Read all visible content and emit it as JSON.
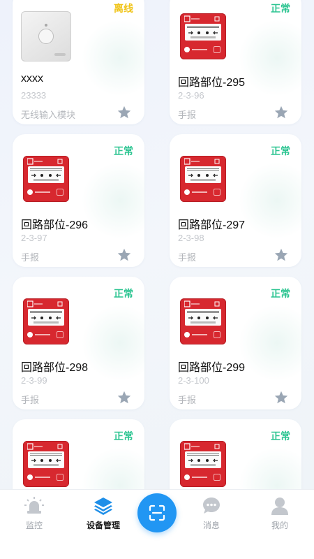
{
  "devices": [
    {
      "status": "离线",
      "status_type": "offline",
      "thumb": "wireless-module",
      "name": "xxxx",
      "code": "23333",
      "type": "无线输入模块"
    },
    {
      "status": "正常",
      "status_type": "normal",
      "thumb": "fire-alarm-button",
      "name": "回路部位-295",
      "code": "2-3-96",
      "type": "手报"
    },
    {
      "status": "正常",
      "status_type": "normal",
      "thumb": "fire-alarm-button",
      "name": "回路部位-296",
      "code": "2-3-97",
      "type": "手报"
    },
    {
      "status": "正常",
      "status_type": "normal",
      "thumb": "fire-alarm-button",
      "name": "回路部位-297",
      "code": "2-3-98",
      "type": "手报"
    },
    {
      "status": "正常",
      "status_type": "normal",
      "thumb": "fire-alarm-button",
      "name": "回路部位-298",
      "code": "2-3-99",
      "type": "手报"
    },
    {
      "status": "正常",
      "status_type": "normal",
      "thumb": "fire-alarm-button",
      "name": "回路部位-299",
      "code": "2-3-100",
      "type": "手报"
    },
    {
      "status": "正常",
      "status_type": "normal",
      "thumb": "fire-alarm-button"
    },
    {
      "status": "正常",
      "status_type": "normal",
      "thumb": "fire-alarm-button"
    }
  ],
  "nav": {
    "monitor": "监控",
    "devices": "设备管理",
    "messages": "消息",
    "mine": "我的",
    "active": "devices"
  },
  "colors": {
    "normal": "#2ec592",
    "offline": "#f0c419",
    "accent": "#2196f3",
    "star": "#9aa6b4"
  },
  "icons": {
    "monitor": "alarm-light-icon",
    "devices": "layers-icon",
    "scan": "scan-icon",
    "messages": "chat-bubble-icon",
    "mine": "user-icon",
    "favorite": "star-icon"
  }
}
